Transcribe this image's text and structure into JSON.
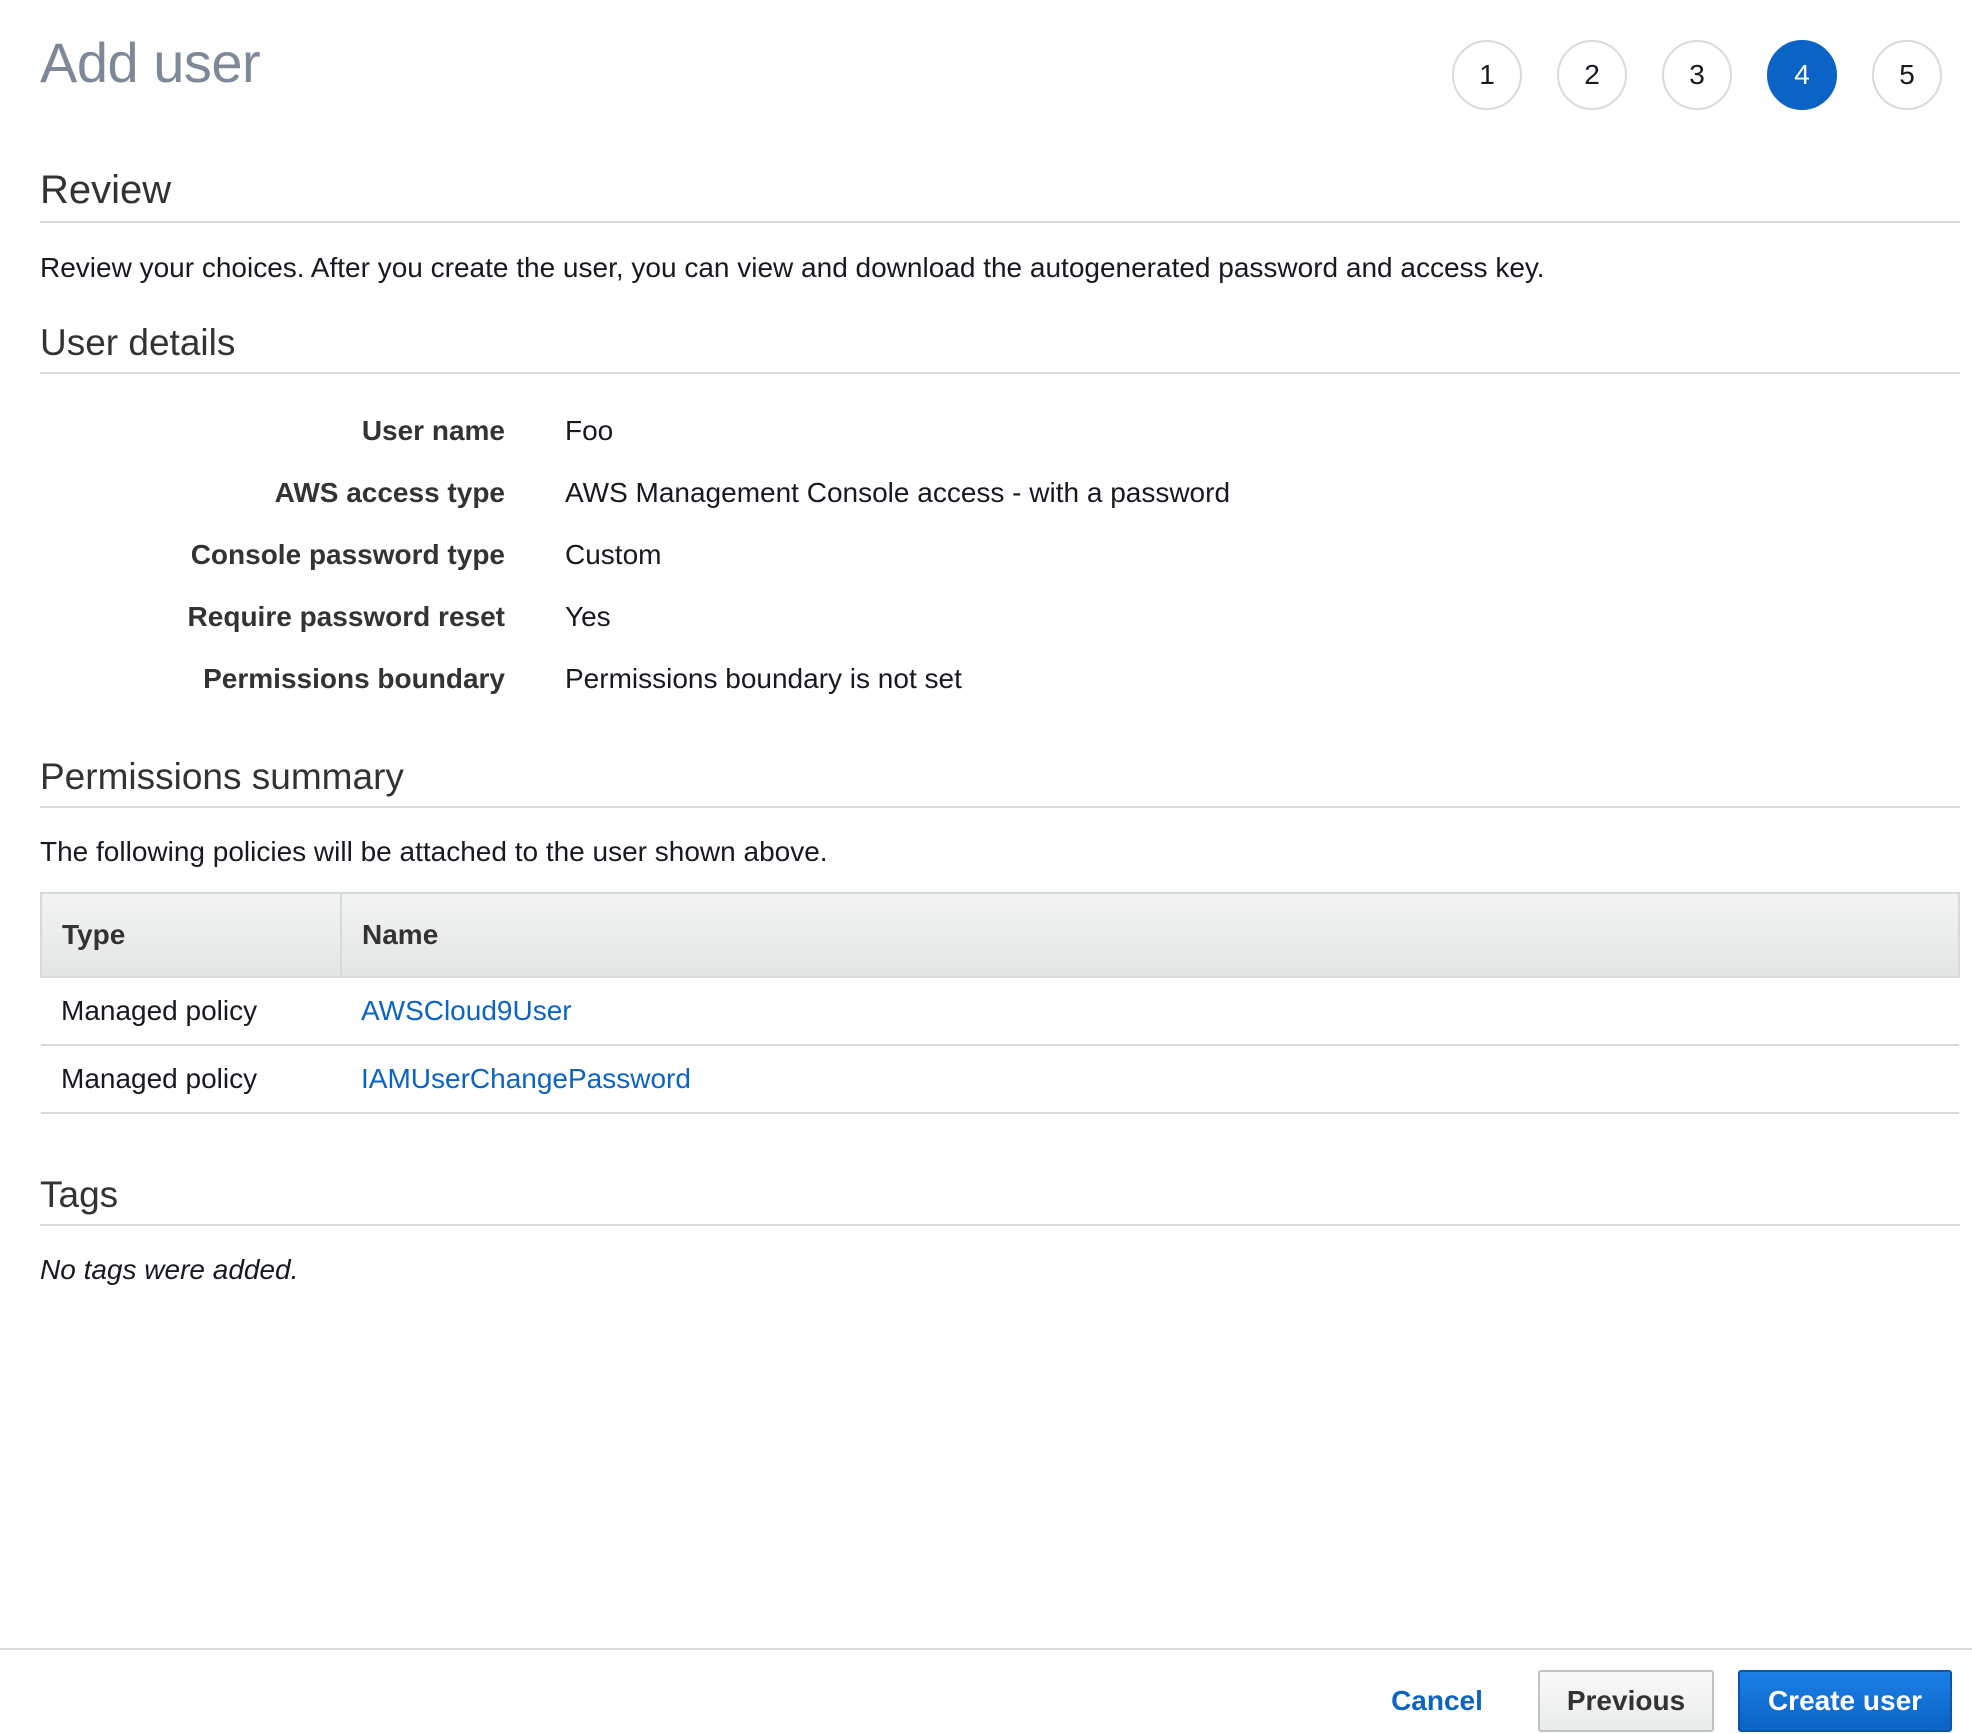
{
  "header": {
    "title": "Add user",
    "steps": [
      "1",
      "2",
      "3",
      "4",
      "5"
    ],
    "active_step": "4"
  },
  "review": {
    "heading": "Review",
    "description": "Review your choices. After you create the user, you can view and download the autogenerated password and access key."
  },
  "user_details": {
    "heading": "User details",
    "rows": [
      {
        "label": "User name",
        "value": "Foo"
      },
      {
        "label": "AWS access type",
        "value": "AWS Management Console access - with a password"
      },
      {
        "label": "Console password type",
        "value": "Custom"
      },
      {
        "label": "Require password reset",
        "value": "Yes"
      },
      {
        "label": "Permissions boundary",
        "value": "Permissions boundary is not set"
      }
    ]
  },
  "permissions": {
    "heading": "Permissions summary",
    "description": "The following policies will be attached to the user shown above.",
    "columns": [
      "Type",
      "Name"
    ],
    "rows": [
      {
        "type": "Managed policy",
        "name": "AWSCloud9User"
      },
      {
        "type": "Managed policy",
        "name": "IAMUserChangePassword"
      }
    ]
  },
  "tags": {
    "heading": "Tags",
    "empty_text": "No tags were added."
  },
  "footer": {
    "cancel_label": "Cancel",
    "previous_label": "Previous",
    "create_label": "Create user"
  },
  "colors": {
    "accent": "#0b63c5",
    "title_gray": "#7d8998",
    "border": "#d5dbdb"
  }
}
